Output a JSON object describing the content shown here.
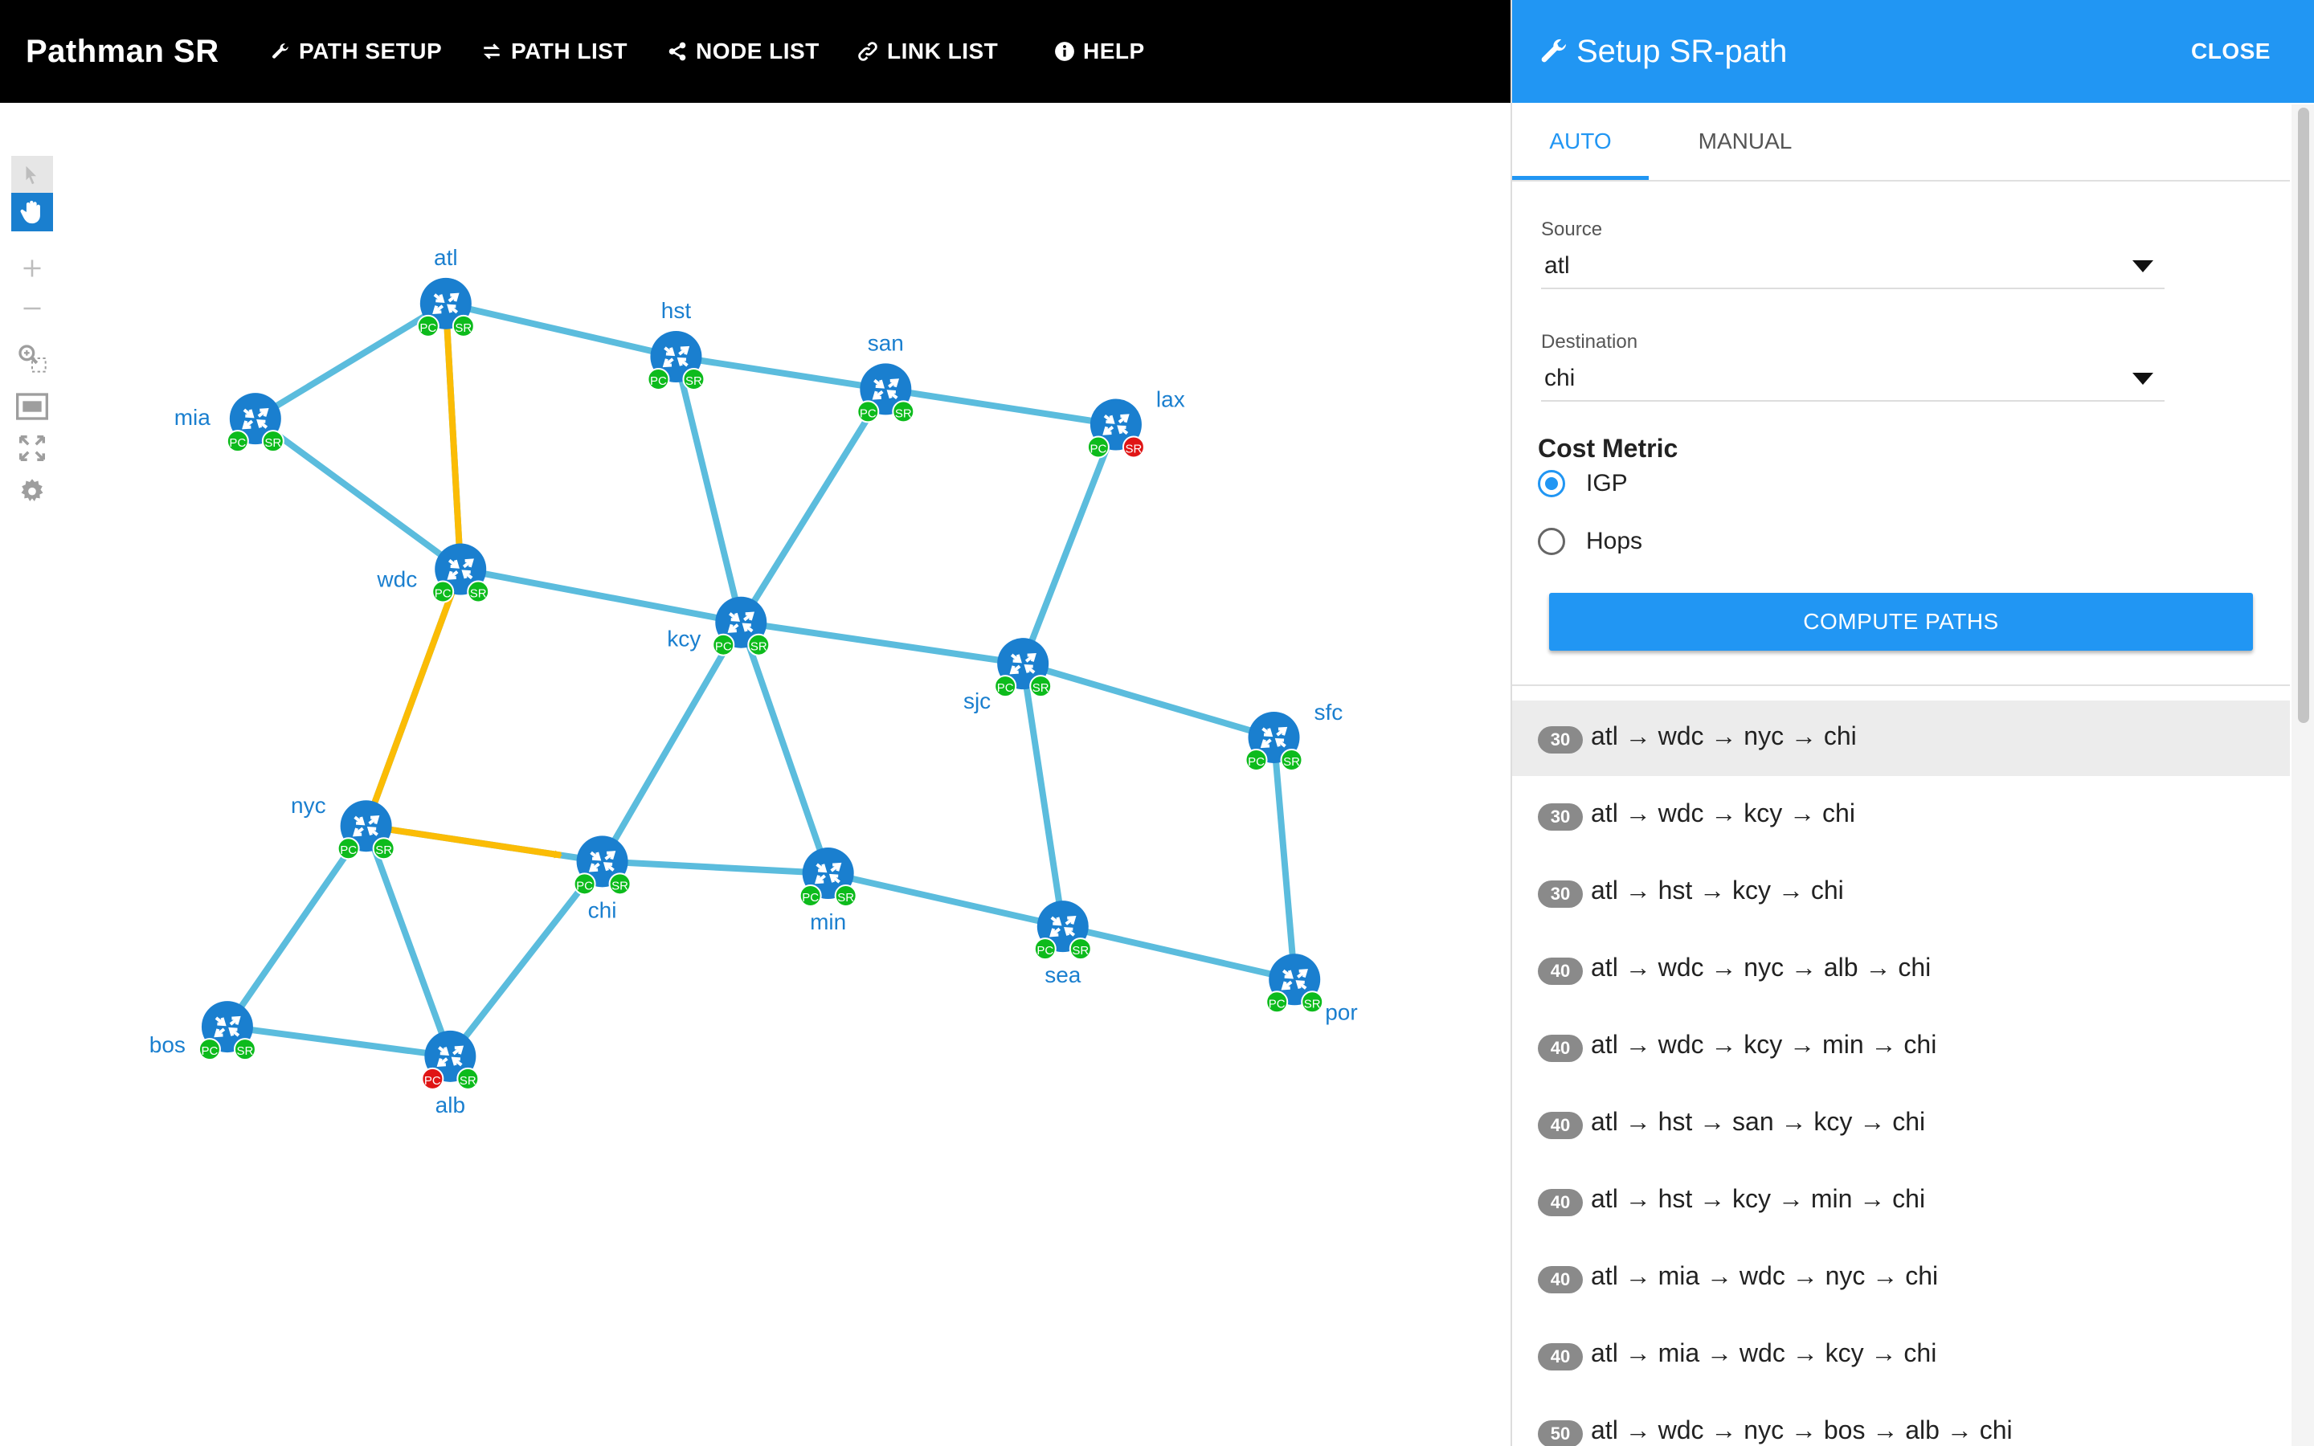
{
  "app": {
    "title": "Pathman SR"
  },
  "nav": [
    {
      "label": "PATH SETUP",
      "icon": "wrench-icon"
    },
    {
      "label": "PATH LIST",
      "icon": "exchange-icon"
    },
    {
      "label": "NODE LIST",
      "icon": "share-icon"
    },
    {
      "label": "LINK LIST",
      "icon": "link-icon"
    },
    {
      "label": "HELP",
      "icon": "info-icon"
    }
  ],
  "colors": {
    "accent": "#2196f3",
    "link": "#5bbcdd",
    "highlight": "#fbbc05",
    "node": "#1a7fcf",
    "ok": "#0dbb1c",
    "bad": "#e01515"
  },
  "panel": {
    "title": "Setup SR-path",
    "close_label": "CLOSE",
    "tabs": {
      "auto": "AUTO",
      "manual": "MANUAL"
    },
    "source": {
      "label": "Source",
      "value": "atl"
    },
    "destination": {
      "label": "Destination",
      "value": "chi"
    },
    "cost": {
      "title": "Cost Metric",
      "options": [
        {
          "label": "IGP",
          "selected": true
        },
        {
          "label": "Hops",
          "selected": false
        }
      ]
    },
    "compute_label": "COMPUTE PATHS",
    "results": [
      {
        "cost": "30",
        "path": "atl → wdc → nyc → chi",
        "selected": true
      },
      {
        "cost": "30",
        "path": "atl → wdc → kcy → chi"
      },
      {
        "cost": "30",
        "path": "atl → hst → kcy → chi"
      },
      {
        "cost": "40",
        "path": "atl → wdc → nyc → alb → chi"
      },
      {
        "cost": "40",
        "path": "atl → wdc → kcy → min → chi"
      },
      {
        "cost": "40",
        "path": "atl → hst → san → kcy → chi"
      },
      {
        "cost": "40",
        "path": "atl → hst → kcy → min → chi"
      },
      {
        "cost": "40",
        "path": "atl → mia → wdc → nyc → chi"
      },
      {
        "cost": "40",
        "path": "atl → mia → wdc → kcy → chi"
      },
      {
        "cost": "50",
        "path": "atl → wdc → nyc → bos → alb → chi"
      }
    ]
  },
  "topology": {
    "nodes": [
      {
        "id": "atl",
        "label": "atl",
        "pc": "ok",
        "sr": "ok"
      },
      {
        "id": "hst",
        "label": "hst",
        "pc": "ok",
        "sr": "ok"
      },
      {
        "id": "san",
        "label": "san",
        "pc": "ok",
        "sr": "ok"
      },
      {
        "id": "lax",
        "label": "lax",
        "pc": "ok",
        "sr": "bad"
      },
      {
        "id": "mia",
        "label": "mia",
        "pc": "ok",
        "sr": "ok"
      },
      {
        "id": "wdc",
        "label": "wdc",
        "pc": "ok",
        "sr": "ok"
      },
      {
        "id": "kcy",
        "label": "kcy",
        "pc": "ok",
        "sr": "ok"
      },
      {
        "id": "sjc",
        "label": "sjc",
        "pc": "ok",
        "sr": "ok"
      },
      {
        "id": "sfc",
        "label": "sfc",
        "pc": "ok",
        "sr": "ok"
      },
      {
        "id": "nyc",
        "label": "nyc",
        "pc": "ok",
        "sr": "ok"
      },
      {
        "id": "chi",
        "label": "chi",
        "pc": "ok",
        "sr": "ok"
      },
      {
        "id": "min",
        "label": "min",
        "pc": "ok",
        "sr": "ok"
      },
      {
        "id": "sea",
        "label": "sea",
        "pc": "ok",
        "sr": "ok"
      },
      {
        "id": "por",
        "label": "por",
        "pc": "ok",
        "sr": "ok"
      },
      {
        "id": "bos",
        "label": "bos",
        "pc": "ok",
        "sr": "ok"
      },
      {
        "id": "alb",
        "label": "alb",
        "pc": "bad",
        "sr": "ok"
      }
    ],
    "links": [
      [
        "atl",
        "hst"
      ],
      [
        "atl",
        "mia"
      ],
      [
        "atl",
        "wdc"
      ],
      [
        "mia",
        "wdc"
      ],
      [
        "hst",
        "san"
      ],
      [
        "hst",
        "kcy"
      ],
      [
        "san",
        "lax"
      ],
      [
        "san",
        "kcy"
      ],
      [
        "lax",
        "sjc"
      ],
      [
        "wdc",
        "kcy"
      ],
      [
        "wdc",
        "nyc"
      ],
      [
        "kcy",
        "sjc"
      ],
      [
        "kcy",
        "chi"
      ],
      [
        "kcy",
        "min"
      ],
      [
        "sjc",
        "sfc"
      ],
      [
        "sjc",
        "sea"
      ],
      [
        "sfc",
        "por"
      ],
      [
        "nyc",
        "chi"
      ],
      [
        "nyc",
        "bos"
      ],
      [
        "nyc",
        "alb"
      ],
      [
        "bos",
        "alb"
      ],
      [
        "alb",
        "chi"
      ],
      [
        "chi",
        "min"
      ],
      [
        "min",
        "sea"
      ],
      [
        "sea",
        "por"
      ]
    ],
    "highlight_path": [
      "atl",
      "wdc",
      "nyc",
      "chi"
    ],
    "badge_pc": "PC",
    "badge_sr": "SR"
  }
}
